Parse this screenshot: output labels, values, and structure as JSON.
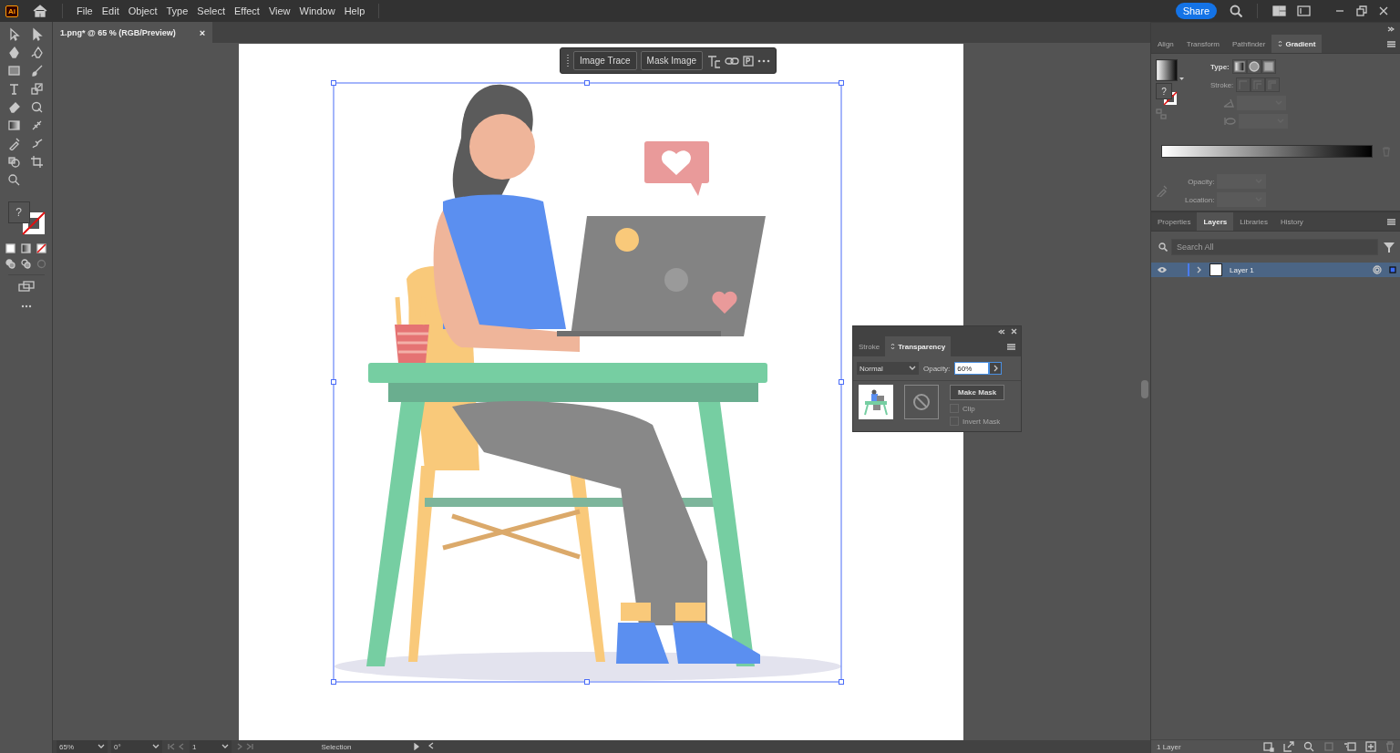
{
  "menu_bar": {
    "app_icon": "Ai",
    "menus": [
      "File",
      "Edit",
      "Object",
      "Type",
      "Select",
      "Effect",
      "View",
      "Window",
      "Help"
    ],
    "share_button": "Share"
  },
  "document_tab": {
    "title": "1.png* @ 65 % (RGB/Preview)",
    "close": "×"
  },
  "toolbar": {
    "fill_indicator": "?"
  },
  "context_bar": {
    "buttons": [
      "Image Trace",
      "Mask Image"
    ]
  },
  "transparency_panel": {
    "tabs": [
      {
        "label": "Stroke",
        "selected": false
      },
      {
        "label": "Transparency",
        "selected": true
      }
    ],
    "blend_mode": "Normal",
    "opacity_label": "Opacity:",
    "opacity_value": "60%",
    "make_mask_button": "Make Mask",
    "options": [
      {
        "label": "Clip",
        "checked": false,
        "disabled": true
      },
      {
        "label": "Invert Mask",
        "checked": false,
        "disabled": true
      }
    ]
  },
  "gradient_panel": {
    "tabs": [
      {
        "label": "Align",
        "selected": false
      },
      {
        "label": "Transform",
        "selected": false
      },
      {
        "label": "Pathfinder",
        "selected": false
      },
      {
        "label": "Gradient",
        "selected": true
      }
    ],
    "type_label": "Type:",
    "stroke_label": "Stroke:",
    "fill_indicator": "?",
    "opacity_label": "Opacity:",
    "location_label": "Location:"
  },
  "layers_panel": {
    "tabs": [
      {
        "label": "Properties",
        "selected": false
      },
      {
        "label": "Layers",
        "selected": true
      },
      {
        "label": "Libraries",
        "selected": false
      },
      {
        "label": "History",
        "selected": false
      }
    ],
    "search": {
      "placeholder": "Search All"
    },
    "layers": [
      {
        "name": "Layer 1",
        "visible": true,
        "expanded": false,
        "selected": true
      }
    ],
    "footer": "1 Layer"
  },
  "status_bar": {
    "zoom": "65%",
    "rotation": "0°",
    "artboard": "1",
    "tool": "Selection"
  }
}
